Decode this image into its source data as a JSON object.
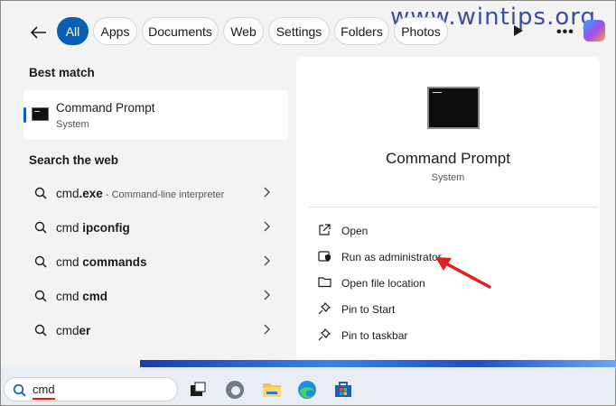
{
  "watermark": "www.wintips.org",
  "filters": [
    "All",
    "Apps",
    "Documents",
    "Web",
    "Settings",
    "Folders",
    "Photos"
  ],
  "best_match": {
    "heading": "Best match",
    "title": "Command Prompt",
    "subtitle": "System"
  },
  "web": {
    "heading": "Search the web",
    "items": [
      {
        "prefix": "cmd",
        "bold": ".exe",
        "suffix": " - Command-line interpreter"
      },
      {
        "prefix": "cmd ",
        "bold": "ipconfig",
        "suffix": ""
      },
      {
        "prefix": "cmd ",
        "bold": "commands",
        "suffix": ""
      },
      {
        "prefix": "cmd ",
        "bold": "cmd",
        "suffix": ""
      },
      {
        "prefix": "cmd",
        "bold": "er",
        "suffix": ""
      }
    ]
  },
  "details": {
    "title": "Command Prompt",
    "subtitle": "System",
    "actions": [
      "Open",
      "Run as administrator",
      "Open file location",
      "Pin to Start",
      "Pin to taskbar"
    ]
  },
  "taskbar": {
    "search_value": "cmd",
    "icons": [
      "task-view-icon",
      "edge-dev-icon",
      "file-explorer-icon",
      "edge-icon",
      "store-icon"
    ]
  },
  "colors": {
    "accent": "#0a5fb4",
    "arrow": "#e02020",
    "underline": "#d81b1b"
  }
}
